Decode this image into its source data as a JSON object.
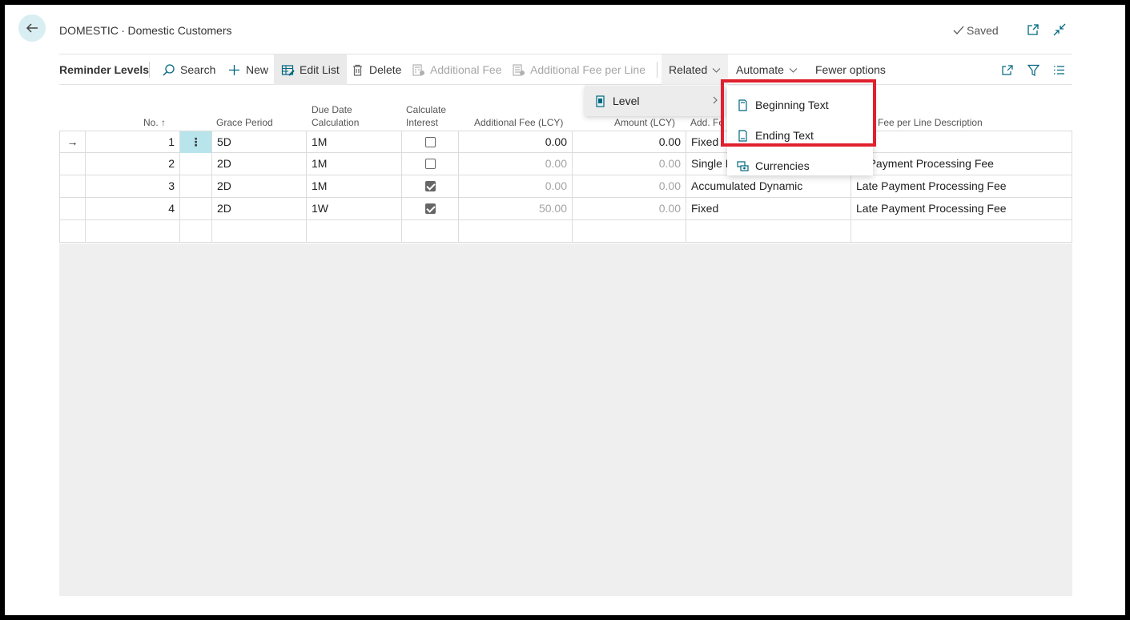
{
  "header": {
    "page_title": "DOMESTIC ∙ Domestic Customers",
    "saved_label": "Saved"
  },
  "actionbar": {
    "title": "Reminder Levels",
    "search": "Search",
    "new": "New",
    "edit_list": "Edit List",
    "delete": "Delete",
    "additional_fee": "Additional Fee",
    "additional_fee_per_line": "Additional Fee per Line",
    "related": "Related",
    "automate": "Automate",
    "fewer_options": "Fewer options"
  },
  "columns": {
    "no": "No.",
    "grace_period": "Grace Period",
    "due_date_1": "Due Date",
    "due_date_2": "Calculation",
    "calc_interest_1": "Calculate",
    "calc_interest_2": "Interest",
    "additional_fee_lcy": "Additional Fee (LCY)",
    "amount_lcy": "Amount (LCY)",
    "add_fee": "Add. Fe",
    "fee_per_line_desc": "Fee per Line Description"
  },
  "rows": [
    {
      "no": "1",
      "grace": "5D",
      "due": "1M",
      "interest": false,
      "fee": "0.00",
      "amount": "0.00",
      "type": "Fixed",
      "desc": ""
    },
    {
      "no": "2",
      "grace": "2D",
      "due": "1M",
      "interest": false,
      "fee": "0.00",
      "amount": "0.00",
      "type": "Single D",
      "desc": "te Payment Processing Fee"
    },
    {
      "no": "3",
      "grace": "2D",
      "due": "1M",
      "interest": true,
      "fee": "0.00",
      "amount": "0.00",
      "type": "Accumulated Dynamic",
      "desc": "Late Payment Processing Fee"
    },
    {
      "no": "4",
      "grace": "2D",
      "due": "1W",
      "interest": true,
      "fee": "50.00",
      "amount": "0.00",
      "type": "Fixed",
      "desc": "Late Payment Processing Fee"
    }
  ],
  "related_menu": {
    "level": "Level",
    "submenu": {
      "beginning_text": "Beginning Text",
      "ending_text": "Ending Text",
      "currencies": "Currencies"
    }
  },
  "colors": {
    "accent": "#00677f",
    "highlight": "#e0202e",
    "selected_cell": "#b8e4eb"
  }
}
